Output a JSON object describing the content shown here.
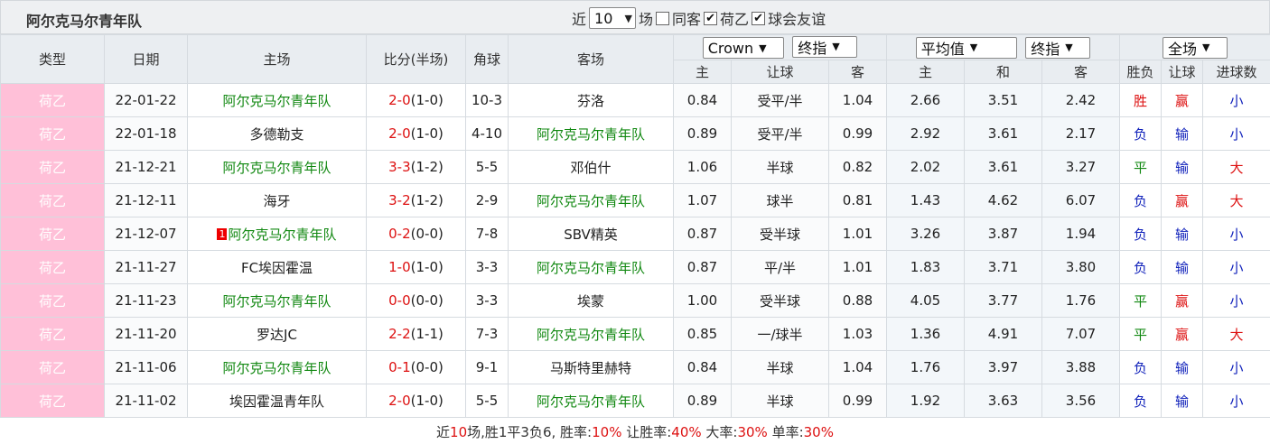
{
  "header": {
    "team_name": "阿尔克马尔青年队",
    "recent_label": "近",
    "recent_count": "10",
    "games_label": "场",
    "same_home_label": "同客",
    "same_home_checked": false,
    "league_label": "荷乙",
    "league_checked": true,
    "friendly_label": "球会友谊",
    "friendly_checked": true
  },
  "columns": {
    "type": "类型",
    "date": "日期",
    "home": "主场",
    "score": "比分(半场)",
    "corner": "角球",
    "away": "客场",
    "company_select": "Crown",
    "odds_mode_select": "终指",
    "avg_select": "平均值",
    "avg_mode_select": "终指",
    "scope_select": "全场",
    "sub": {
      "ah_home": "主",
      "ah_handicap": "让球",
      "ah_away": "客",
      "eu_home": "主",
      "eu_draw": "和",
      "eu_away": "客",
      "result": "胜负",
      "handicap_result": "让球",
      "goals_result": "进球数"
    }
  },
  "matches": [
    {
      "type": "荷乙",
      "date": "22-01-22",
      "home": "阿尔克马尔青年队",
      "home_is_team": true,
      "home_redcard": "",
      "score": "2-0",
      "half": "(1-0)",
      "corner": "10-3",
      "away": "芬洛",
      "away_is_team": false,
      "ah_home": "0.84",
      "handicap": "受平/半",
      "ah_away": "1.04",
      "eu_home": "2.66",
      "eu_draw": "3.51",
      "eu_away": "2.42",
      "result": "胜",
      "ah_result": "赢",
      "goals": "小"
    },
    {
      "type": "荷乙",
      "date": "22-01-18",
      "home": "多德勒支",
      "home_is_team": false,
      "home_redcard": "",
      "score": "2-0",
      "half": "(1-0)",
      "corner": "4-10",
      "away": "阿尔克马尔青年队",
      "away_is_team": true,
      "ah_home": "0.89",
      "handicap": "受平/半",
      "ah_away": "0.99",
      "eu_home": "2.92",
      "eu_draw": "3.61",
      "eu_away": "2.17",
      "result": "负",
      "ah_result": "输",
      "goals": "小"
    },
    {
      "type": "荷乙",
      "date": "21-12-21",
      "home": "阿尔克马尔青年队",
      "home_is_team": true,
      "home_redcard": "",
      "score": "3-3",
      "half": "(1-2)",
      "corner": "5-5",
      "away": "邓伯什",
      "away_is_team": false,
      "ah_home": "1.06",
      "handicap": "半球",
      "ah_away": "0.82",
      "eu_home": "2.02",
      "eu_draw": "3.61",
      "eu_away": "3.27",
      "result": "平",
      "ah_result": "输",
      "goals": "大"
    },
    {
      "type": "荷乙",
      "date": "21-12-11",
      "home": "海牙",
      "home_is_team": false,
      "home_redcard": "",
      "score": "3-2",
      "half": "(1-2)",
      "corner": "2-9",
      "away": "阿尔克马尔青年队",
      "away_is_team": true,
      "ah_home": "1.07",
      "handicap": "球半",
      "ah_away": "0.81",
      "eu_home": "1.43",
      "eu_draw": "4.62",
      "eu_away": "6.07",
      "result": "负",
      "ah_result": "赢",
      "goals": "大"
    },
    {
      "type": "荷乙",
      "date": "21-12-07",
      "home": "阿尔克马尔青年队",
      "home_is_team": true,
      "home_redcard": "1",
      "score": "0-2",
      "half": "(0-0)",
      "corner": "7-8",
      "away": "SBV精英",
      "away_is_team": false,
      "ah_home": "0.87",
      "handicap": "受半球",
      "ah_away": "1.01",
      "eu_home": "3.26",
      "eu_draw": "3.87",
      "eu_away": "1.94",
      "result": "负",
      "ah_result": "输",
      "goals": "小"
    },
    {
      "type": "荷乙",
      "date": "21-11-27",
      "home": "FC埃因霍温",
      "home_is_team": false,
      "home_redcard": "",
      "score": "1-0",
      "half": "(1-0)",
      "corner": "3-3",
      "away": "阿尔克马尔青年队",
      "away_is_team": true,
      "ah_home": "0.87",
      "handicap": "平/半",
      "ah_away": "1.01",
      "eu_home": "1.83",
      "eu_draw": "3.71",
      "eu_away": "3.80",
      "result": "负",
      "ah_result": "输",
      "goals": "小"
    },
    {
      "type": "荷乙",
      "date": "21-11-23",
      "home": "阿尔克马尔青年队",
      "home_is_team": true,
      "home_redcard": "",
      "score": "0-0",
      "half": "(0-0)",
      "corner": "3-3",
      "away": "埃蒙",
      "away_is_team": false,
      "ah_home": "1.00",
      "handicap": "受半球",
      "ah_away": "0.88",
      "eu_home": "4.05",
      "eu_draw": "3.77",
      "eu_away": "1.76",
      "result": "平",
      "ah_result": "赢",
      "goals": "小"
    },
    {
      "type": "荷乙",
      "date": "21-11-20",
      "home": "罗达JC",
      "home_is_team": false,
      "home_redcard": "",
      "score": "2-2",
      "half": "(1-1)",
      "corner": "7-3",
      "away": "阿尔克马尔青年队",
      "away_is_team": true,
      "ah_home": "0.85",
      "handicap": "一/球半",
      "ah_away": "1.03",
      "eu_home": "1.36",
      "eu_draw": "4.91",
      "eu_away": "7.07",
      "result": "平",
      "ah_result": "赢",
      "goals": "大"
    },
    {
      "type": "荷乙",
      "date": "21-11-06",
      "home": "阿尔克马尔青年队",
      "home_is_team": true,
      "home_redcard": "",
      "score": "0-1",
      "half": "(0-0)",
      "corner": "9-1",
      "away": "马斯特里赫特",
      "away_is_team": false,
      "ah_home": "0.84",
      "handicap": "半球",
      "ah_away": "1.04",
      "eu_home": "1.76",
      "eu_draw": "3.97",
      "eu_away": "3.88",
      "result": "负",
      "ah_result": "输",
      "goals": "小"
    },
    {
      "type": "荷乙",
      "date": "21-11-02",
      "home": "埃因霍温青年队",
      "home_is_team": false,
      "home_redcard": "",
      "score": "2-0",
      "half": "(1-0)",
      "corner": "5-5",
      "away": "阿尔克马尔青年队",
      "away_is_team": true,
      "ah_home": "0.89",
      "handicap": "半球",
      "ah_away": "0.99",
      "eu_home": "1.92",
      "eu_draw": "3.63",
      "eu_away": "3.56",
      "result": "负",
      "ah_result": "输",
      "goals": "小"
    }
  ],
  "summary": {
    "prefix": "近",
    "count": "10",
    "text1": "场,胜1平3负6, 胜率:",
    "win_rate": "10%",
    "text2": " 让胜率:",
    "ah_rate": "40%",
    "text3": " 大率:",
    "big_rate": "30%",
    "text4": " 单率:",
    "odd_rate": "30%"
  },
  "colors": {
    "team": "#118811",
    "score": "#dd1111",
    "win": "#dd1111",
    "lose": "#1122bb",
    "draw": "#118811",
    "type_bg": "#ffc0d8"
  }
}
